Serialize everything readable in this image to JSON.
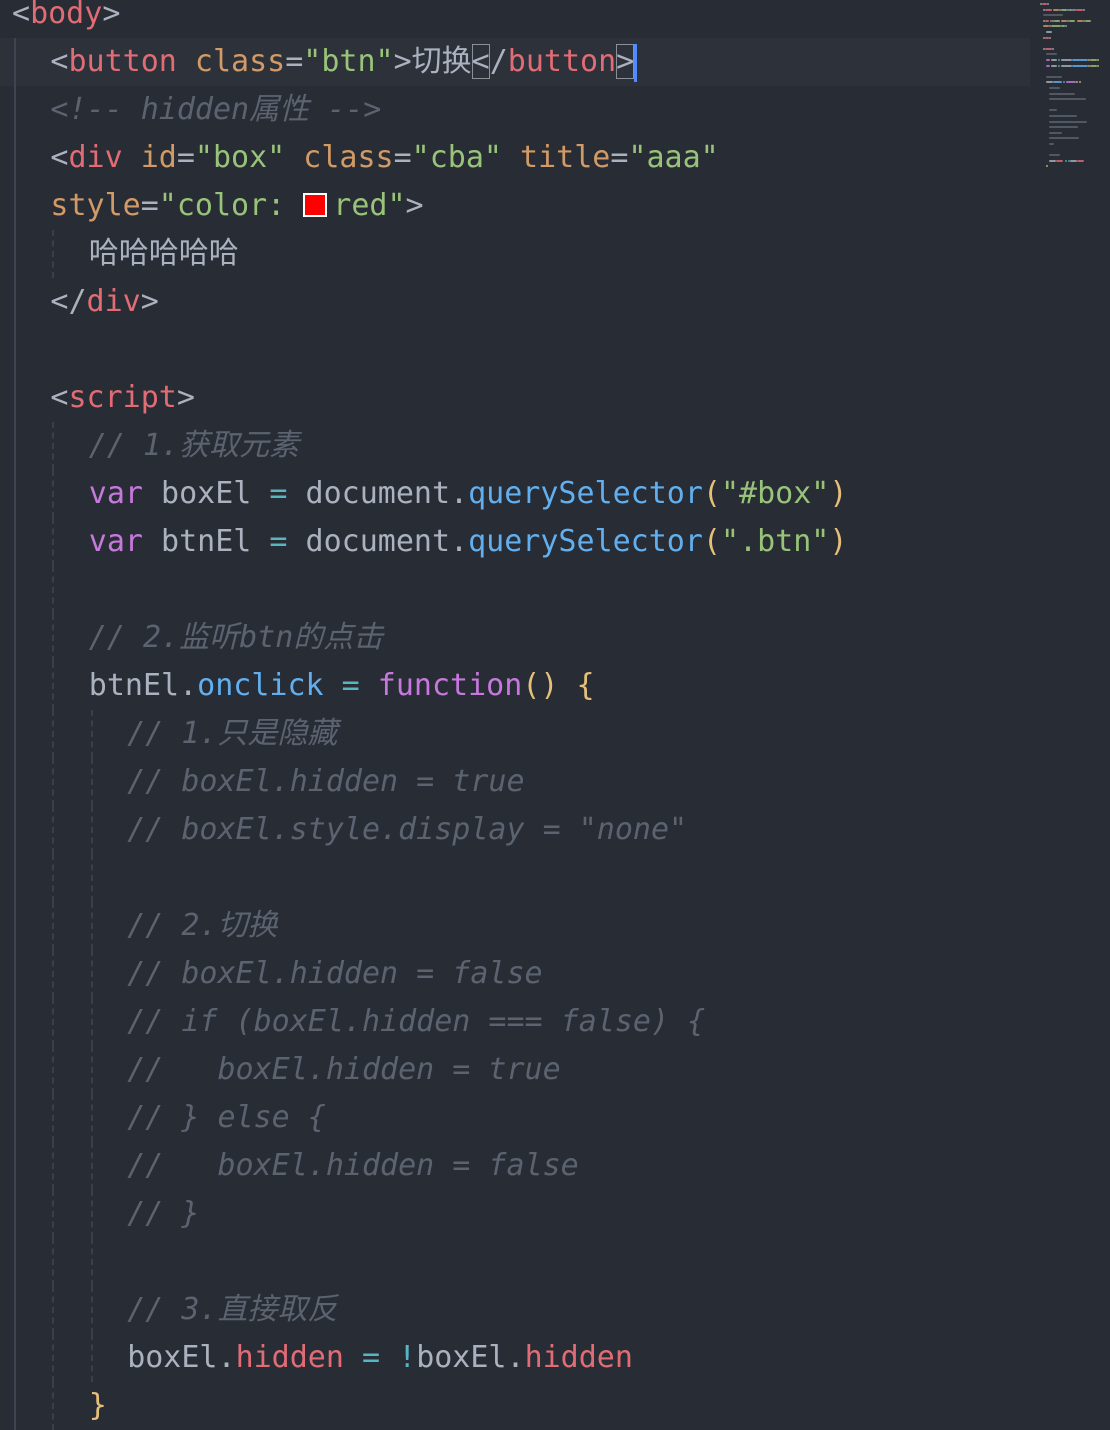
{
  "editor": {
    "theme_colors": {
      "background": "#282c34",
      "tag": "#e06c75",
      "attribute": "#d19a66",
      "string": "#98c379",
      "comment": "#5c6370",
      "keyword": "#c678dd",
      "function": "#61afef",
      "operator": "#56b6c2",
      "brace": "#e5c07b",
      "cursor": "#528bff"
    },
    "active_line": 2,
    "color_swatch": {
      "value": "red",
      "hex": "#ff0000"
    },
    "lines": [
      {
        "indent": 0,
        "tokens": [
          [
            "tag-punct",
            "<"
          ],
          [
            "tag",
            "body"
          ],
          [
            "tag-punct",
            ">"
          ]
        ]
      },
      {
        "indent": 1,
        "tokens": [
          [
            "tag-punct",
            "<"
          ],
          [
            "tag",
            "button"
          ],
          [
            "sp",
            " "
          ],
          [
            "attr",
            "class"
          ],
          [
            "punct",
            "="
          ],
          [
            "str",
            "\"btn\""
          ],
          [
            "tag-punct",
            ">"
          ],
          [
            "cjk",
            "切换"
          ],
          [
            "match",
            "<"
          ],
          [
            "tag-punct",
            "/"
          ],
          [
            "tag",
            "button"
          ],
          [
            "match",
            ">"
          ],
          [
            "cursor",
            ""
          ]
        ]
      },
      {
        "indent": 1,
        "tokens": [
          [
            "cmt",
            "<!-- hidden属性 -->"
          ]
        ]
      },
      {
        "indent": 1,
        "tokens": [
          [
            "tag-punct",
            "<"
          ],
          [
            "tag",
            "div"
          ],
          [
            "sp",
            " "
          ],
          [
            "attr",
            "id"
          ],
          [
            "punct",
            "="
          ],
          [
            "str",
            "\"box\""
          ],
          [
            "sp",
            " "
          ],
          [
            "attr",
            "class"
          ],
          [
            "punct",
            "="
          ],
          [
            "str",
            "\"cba\""
          ],
          [
            "sp",
            " "
          ],
          [
            "attr",
            "title"
          ],
          [
            "punct",
            "="
          ],
          [
            "str",
            "\"aaa\""
          ]
        ]
      },
      {
        "indent": 1,
        "tokens": [
          [
            "attr",
            "style"
          ],
          [
            "punct",
            "="
          ],
          [
            "str",
            "\"color: "
          ],
          [
            "swatch",
            ""
          ],
          [
            "str",
            "red\""
          ],
          [
            "tag-punct",
            ">"
          ]
        ]
      },
      {
        "indent": 2,
        "tokens": [
          [
            "cjk",
            "哈哈哈哈哈"
          ]
        ]
      },
      {
        "indent": 1,
        "tokens": [
          [
            "tag-punct",
            "</"
          ],
          [
            "tag",
            "div"
          ],
          [
            "tag-punct",
            ">"
          ]
        ]
      },
      {
        "indent": 1,
        "tokens": []
      },
      {
        "indent": 1,
        "tokens": [
          [
            "tag-punct",
            "<"
          ],
          [
            "tag",
            "script"
          ],
          [
            "tag-punct",
            ">"
          ]
        ]
      },
      {
        "indent": 2,
        "tokens": [
          [
            "cmt",
            "// 1.获取元素"
          ]
        ]
      },
      {
        "indent": 2,
        "tokens": [
          [
            "kw",
            "var"
          ],
          [
            "sp",
            " "
          ],
          [
            "plain",
            "boxEl"
          ],
          [
            "sp",
            " "
          ],
          [
            "op",
            "="
          ],
          [
            "sp",
            " "
          ],
          [
            "plain",
            "document."
          ],
          [
            "fn",
            "querySelector"
          ],
          [
            "brace",
            "("
          ],
          [
            "str",
            "\"#box\""
          ],
          [
            "brace",
            ")"
          ]
        ]
      },
      {
        "indent": 2,
        "tokens": [
          [
            "kw",
            "var"
          ],
          [
            "sp",
            " "
          ],
          [
            "plain",
            "btnEl"
          ],
          [
            "sp",
            " "
          ],
          [
            "op",
            "="
          ],
          [
            "sp",
            " "
          ],
          [
            "plain",
            "document."
          ],
          [
            "fn",
            "querySelector"
          ],
          [
            "brace",
            "("
          ],
          [
            "str",
            "\".btn\""
          ],
          [
            "brace",
            ")"
          ]
        ]
      },
      {
        "indent": 2,
        "tokens": []
      },
      {
        "indent": 2,
        "tokens": [
          [
            "cmt",
            "// 2.监听btn的点击"
          ]
        ]
      },
      {
        "indent": 2,
        "tokens": [
          [
            "plain",
            "btnEl."
          ],
          [
            "fn",
            "onclick"
          ],
          [
            "sp",
            " "
          ],
          [
            "op",
            "="
          ],
          [
            "sp",
            " "
          ],
          [
            "kw",
            "function"
          ],
          [
            "brace",
            "()"
          ],
          [
            "sp",
            " "
          ],
          [
            "brace",
            "{"
          ]
        ]
      },
      {
        "indent": 3,
        "tokens": [
          [
            "cmt",
            "// 1.只是隐藏"
          ]
        ]
      },
      {
        "indent": 3,
        "tokens": [
          [
            "cmt",
            "// boxEl.hidden = true"
          ]
        ]
      },
      {
        "indent": 3,
        "tokens": [
          [
            "cmt",
            "// boxEl.style.display = \"none\""
          ]
        ]
      },
      {
        "indent": 3,
        "tokens": []
      },
      {
        "indent": 3,
        "tokens": [
          [
            "cmt",
            "// 2.切换"
          ]
        ]
      },
      {
        "indent": 3,
        "tokens": [
          [
            "cmt",
            "// boxEl.hidden = false"
          ]
        ]
      },
      {
        "indent": 3,
        "tokens": [
          [
            "cmt",
            "// if (boxEl.hidden === false) {"
          ]
        ]
      },
      {
        "indent": 3,
        "tokens": [
          [
            "cmt",
            "//   boxEl.hidden = true"
          ]
        ]
      },
      {
        "indent": 3,
        "tokens": [
          [
            "cmt",
            "// } else {"
          ]
        ]
      },
      {
        "indent": 3,
        "tokens": [
          [
            "cmt",
            "//   boxEl.hidden = false"
          ]
        ]
      },
      {
        "indent": 3,
        "tokens": [
          [
            "cmt",
            "// }"
          ]
        ]
      },
      {
        "indent": 3,
        "tokens": []
      },
      {
        "indent": 3,
        "tokens": [
          [
            "cmt",
            "// 3.直接取反"
          ]
        ]
      },
      {
        "indent": 3,
        "tokens": [
          [
            "plain",
            "boxEl."
          ],
          [
            "prop",
            "hidden"
          ],
          [
            "sp",
            " "
          ],
          [
            "op",
            "="
          ],
          [
            "sp",
            " "
          ],
          [
            "op",
            "!"
          ],
          [
            "plain",
            "boxEl."
          ],
          [
            "prop",
            "hidden"
          ]
        ]
      },
      {
        "indent": 2,
        "tokens": [
          [
            "brace",
            "}"
          ]
        ]
      }
    ]
  }
}
